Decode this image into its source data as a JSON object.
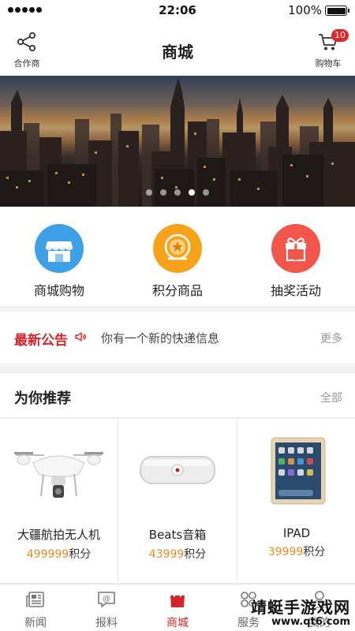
{
  "status_bar": {
    "time": "22:06",
    "battery": "100%"
  },
  "header": {
    "title": "商城",
    "left_label": "合作商",
    "cart_label": "购物车",
    "cart_count": "10"
  },
  "banner": {
    "slides": 5,
    "active_slide": 4
  },
  "categories": [
    {
      "label": "商城购物",
      "icon": "store-icon",
      "color": "#3ea0e6"
    },
    {
      "label": "积分商品",
      "icon": "points-coin-icon",
      "color": "#f7a21b"
    },
    {
      "label": "抽奖活动",
      "icon": "gift-icon",
      "color": "#f2554a"
    }
  ],
  "notice": {
    "title": "最新公告",
    "text": "你有一个新的快递信息",
    "more": "更多"
  },
  "recommend": {
    "title": "为你推荐",
    "all": "全部",
    "products": [
      {
        "name": "大疆航拍无人机",
        "price": "499999",
        "unit": "积分"
      },
      {
        "name": "Beats音箱",
        "price": "43999",
        "unit": "积分"
      },
      {
        "name": "IPAD",
        "price": "39999",
        "unit": "积分"
      }
    ]
  },
  "tabbar": [
    {
      "label": "新闻",
      "icon": "news-icon",
      "active": false
    },
    {
      "label": "报料",
      "icon": "report-icon",
      "active": false
    },
    {
      "label": "商城",
      "icon": "shopping-bag-icon",
      "active": true
    },
    {
      "label": "服务",
      "icon": "service-icon",
      "active": false
    },
    {
      "label": "我的",
      "icon": "profile-icon",
      "active": false
    }
  ],
  "watermark": {
    "text": "靖蜓手游戏网",
    "url": "www.qt6.com"
  },
  "colors": {
    "accent": "#d2262c",
    "price": "#e8891d"
  }
}
